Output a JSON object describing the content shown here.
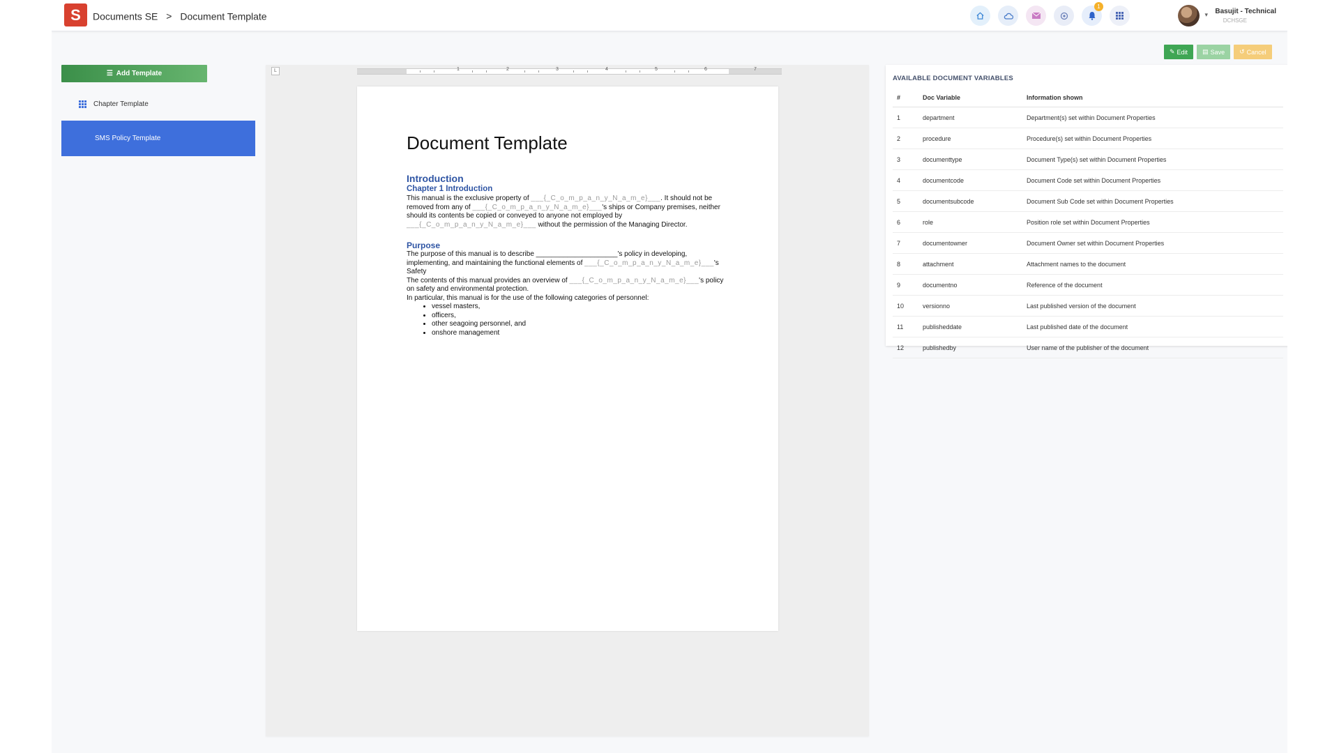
{
  "header": {
    "logo_letter": "S",
    "breadcrumbs": [
      "Documents SE",
      "Document Template"
    ],
    "separator": ">",
    "notification_count": "1",
    "user_name": "Basujit - Technical",
    "user_role": "DCHSGE",
    "icons": [
      "home-icon",
      "cloud-icon",
      "mail-icon",
      "settings-icon",
      "bell-icon",
      "apps-grid-icon"
    ]
  },
  "sidebar": {
    "add_template_label": "Add Template",
    "items": [
      {
        "label": "Chapter Template",
        "icon": "grid-icon"
      },
      {
        "label": "SMS Policy Template",
        "selected": true
      }
    ]
  },
  "toolbar": {
    "edit_label": "Edit",
    "save_label": "Save",
    "cancel_label": "Cancel"
  },
  "editor": {
    "ruler_numbers": [
      "1",
      "2",
      "3",
      "4",
      "5",
      "6",
      "7"
    ],
    "corner_mark": "L"
  },
  "document": {
    "title": "Document Template",
    "h_intro": "Introduction",
    "h_chapter": "Chapter 1 Introduction",
    "p1": {
      "a": "This manual is the exclusive property of ",
      "b": "___{_C_o_m_p_a_n_y_N_a_m_e}___",
      "c": ". It should not be removed from any of ",
      "d": "___{_C_o_m_p_a_n_y_N_a_m_e}___",
      "e": "'s ships or Company premises, neither should its contents be copied or conveyed to anyone not employed by ",
      "f": "___{_C_o_m_p_a_n_y_N_a_m_e}___",
      "g": " without the permission of the Managing Director."
    },
    "h_purpose": "Purpose",
    "p2": {
      "a": "The purpose of this manual is to describe _____________________'s policy in developing, implementing, and maintaining the functional elements of ",
      "b": "___{_C_o_m_p_a_n_y_N_a_m_e}___",
      "c": "'s Safety"
    },
    "p3": {
      "a": "The contents of this manual provides an overview of ",
      "b": "___{_C_o_m_p_a_n_y_N_a_m_e}___",
      "c": "'s policy on safety and environmental protection."
    },
    "p4": "In particular, this manual is for the use of the following categories of personnel:",
    "bullets": [
      "vessel masters,",
      "officers,",
      "other seagoing personnel, and",
      "onshore management"
    ]
  },
  "variables": {
    "title": "AVAILABLE DOCUMENT VARIABLES",
    "headers": [
      "#",
      "Doc Variable",
      "Information shown"
    ],
    "rows": [
      [
        "1",
        "department",
        "Department(s) set within Document Properties"
      ],
      [
        "2",
        "procedure",
        "Procedure(s) set within Document Properties"
      ],
      [
        "3",
        "documenttype",
        "Document Type(s) set within Document Properties"
      ],
      [
        "4",
        "documentcode",
        "Document Code set within Document Properties"
      ],
      [
        "5",
        "documentsubcode",
        "Document Sub Code set within Document Properties"
      ],
      [
        "6",
        "role",
        "Position role set within Document Properties"
      ],
      [
        "7",
        "documentowner",
        "Document Owner set within Document Properties"
      ],
      [
        "8",
        "attachment",
        "Attachment names to the document"
      ],
      [
        "9",
        "documentno",
        "Reference of the document"
      ],
      [
        "10",
        "versionno",
        "Last published version of the document"
      ],
      [
        "11",
        "publisheddate",
        "Last published date of the document"
      ],
      [
        "12",
        "publishedby",
        "User name of the publisher of the document"
      ]
    ]
  },
  "colors": {
    "brand_red": "#d8412f",
    "selected_blue": "#3e6fdc",
    "add_green": "#3b8f49",
    "heading_blue": "#2f55a4",
    "edit_green": "#3fa654",
    "cancel_yellow": "#f5cd7a"
  }
}
